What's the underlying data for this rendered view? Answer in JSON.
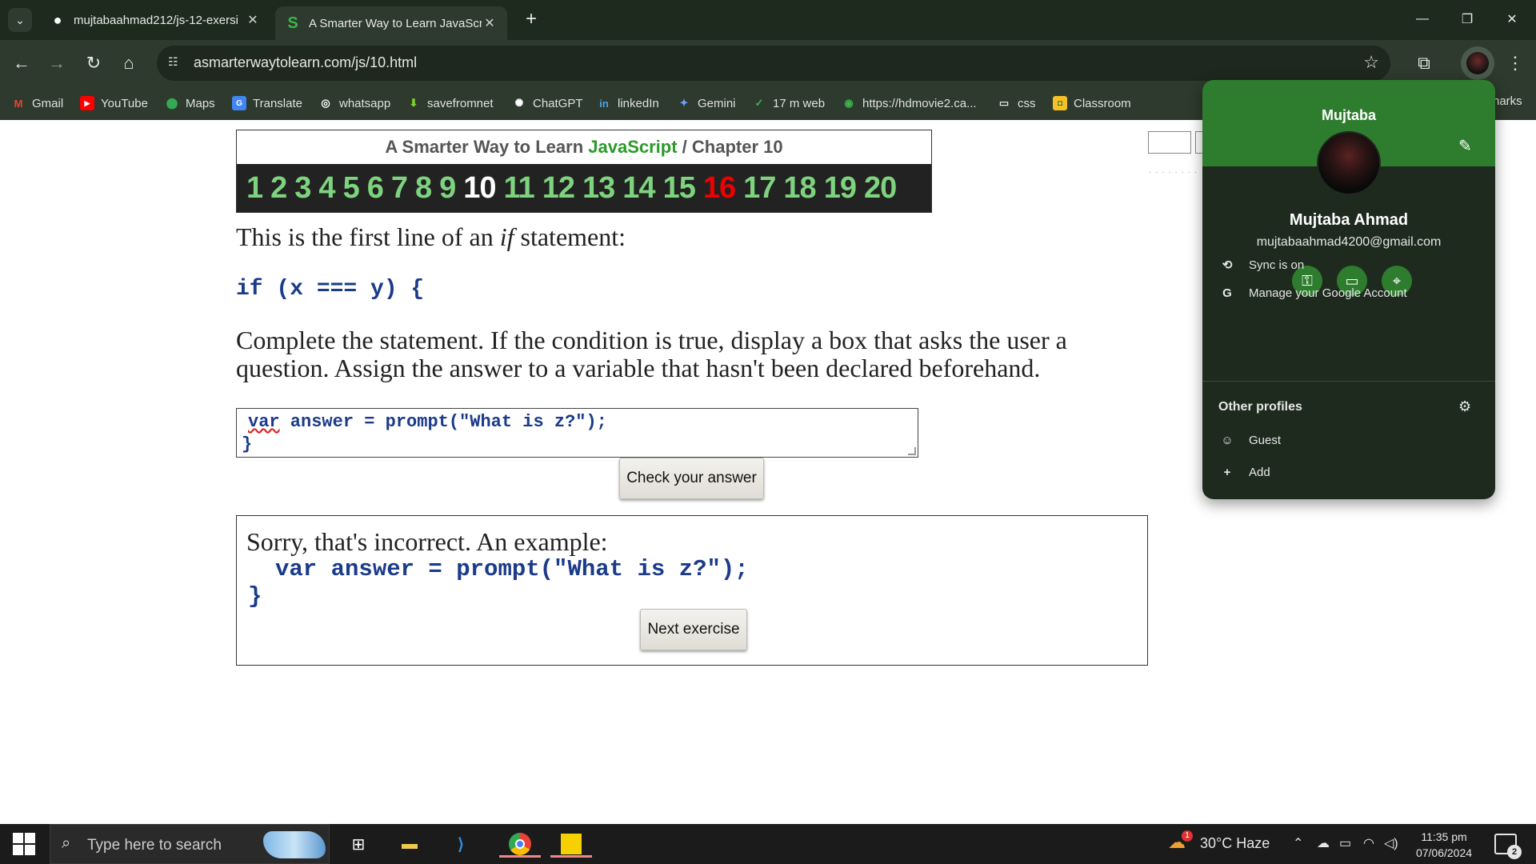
{
  "browser": {
    "tabs": [
      {
        "title": "mujtabaahmad212/js-12-exersi",
        "active": false
      },
      {
        "title": "A Smarter Way to Learn JavaScr",
        "active": true
      }
    ],
    "url": "asmarterwaytolearn.com/js/10.html",
    "bookmarks": [
      "Gmail",
      "YouTube",
      "Maps",
      "Translate",
      "whatsapp",
      "savefromnet",
      "ChatGPT",
      "linkedIn",
      "Gemini",
      "17 m web",
      "https://hdmovie2.ca...",
      "css",
      "Classroom"
    ],
    "bookmarks_overflow": "harks"
  },
  "page": {
    "header_prefix": "A Smarter Way to Learn ",
    "header_js": "JavaScript",
    "header_sep": " / ",
    "header_chapter": "Chapter 10",
    "chapters": [
      "1",
      "2",
      "3",
      "4",
      "5",
      "6",
      "7",
      "8",
      "9",
      "10",
      "11",
      "12",
      "13",
      "14",
      "15",
      "16",
      "17",
      "18",
      "19",
      "20"
    ],
    "current_chapter": "10",
    "highlight_chapter": "16",
    "line1_before": "This is the first line of an ",
    "line1_em": "if",
    "line1_after": " statement:",
    "code_line": "if (x === y) {",
    "instructions": "Complete the statement. If the condition is true, display a box that asks the user a question. Assign the answer to a variable that hasn't been declared beforehand.",
    "answer_var": "var",
    "answer_rest": " answer = prompt(\"What is z?\");",
    "answer_brace": "}",
    "check_button": "Check your answer",
    "result_message": "Sorry, that's incorrect. An example:",
    "result_code": "var answer = prompt(\"What is z?\");",
    "result_brace": "}",
    "next_button": "Next exercise"
  },
  "profile": {
    "header_name": "Mujtaba",
    "full_name": "Mujtaba Ahmad",
    "email": "mujtabaahmad4200@gmail.com",
    "sync": "Sync is on",
    "manage": "Manage your Google Account",
    "other_profiles": "Other profiles",
    "guest": "Guest",
    "add": "Add"
  },
  "taskbar": {
    "search_placeholder": "Type here to search",
    "weather": "30°C  Haze",
    "weather_badge": "1",
    "time": "11:35 pm",
    "date": "07/06/2024",
    "notifications": "2"
  }
}
